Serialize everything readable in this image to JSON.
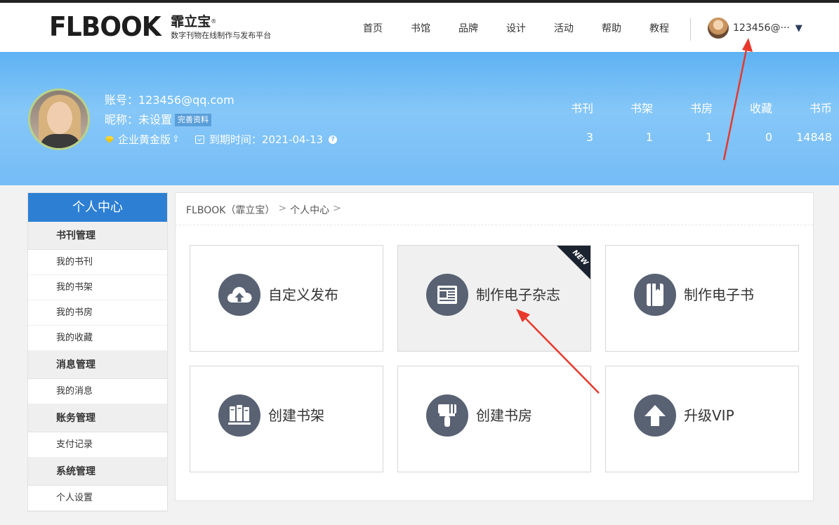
{
  "header": {
    "logo_word": "FLBOOK",
    "logo_cn": "霏立宝",
    "logo_reg": "®",
    "logo_tagline": "数字刊物在线制作与发布平台",
    "nav": [
      "首页",
      "书馆",
      "品牌",
      "设计",
      "活动",
      "帮助",
      "教程"
    ],
    "user_name": "123456@···",
    "caret": "▼"
  },
  "profile": {
    "account": "账号：123456@qq.com",
    "nickname": "昵称：未设置",
    "complete_button": "完善资料",
    "plan": "企业黄金版",
    "plan_icon": "⇪",
    "expiry": "到期时间：2021-04-13",
    "help_glyph": "?",
    "stats": [
      {
        "label": "书刊",
        "value": "3"
      },
      {
        "label": "书架",
        "value": "1"
      },
      {
        "label": "书房",
        "value": "1"
      },
      {
        "label": "收藏",
        "value": "0"
      },
      {
        "label": "书币",
        "value": "14848"
      }
    ]
  },
  "sidebar": {
    "title": "个人中心",
    "groups": [
      {
        "title": "书刊管理",
        "items": [
          "我的书刊",
          "我的书架",
          "我的书房",
          "我的收藏"
        ]
      },
      {
        "title": "消息管理",
        "items": [
          "我的消息"
        ]
      },
      {
        "title": "账务管理",
        "items": [
          "支付记录"
        ]
      },
      {
        "title": "系统管理",
        "items": [
          "个人设置"
        ]
      }
    ]
  },
  "main": {
    "breadcrumb": [
      "FLBOOK（霏立宝）",
      "个人中心"
    ],
    "breadcrumb_sep": ">",
    "cards": [
      {
        "label": "自定义发布",
        "icon": "cloud-upload-icon"
      },
      {
        "label": "制作电子杂志",
        "icon": "magazine-icon",
        "badge": "NEW"
      },
      {
        "label": "制作电子书",
        "icon": "ebook-icon"
      },
      {
        "label": "创建书架",
        "icon": "bookshelf-icon"
      },
      {
        "label": "创建书房",
        "icon": "paint-brush-icon"
      },
      {
        "label": "升级VIP",
        "icon": "arrow-up-icon"
      }
    ]
  },
  "colors": {
    "banner": "#75bcf6",
    "sidebar_title": "#2d7fd3",
    "icon_circle": "#596273",
    "annotation_arrow": "#e8382c"
  }
}
